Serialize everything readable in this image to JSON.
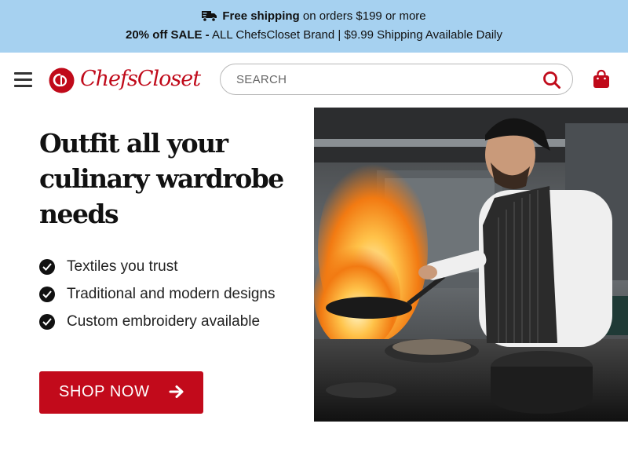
{
  "announcement": {
    "line1_bold": "Free shipping",
    "line1_rest": " on orders $199 or more",
    "line2_bold": "20% off SALE -",
    "line2_rest": " ALL ChefsCloset Brand | $9.99 Shipping Available Daily",
    "background": "#a6d1f0"
  },
  "header": {
    "logo_text": "ChefsCloset",
    "search_placeholder": "SEARCH",
    "search_value": "",
    "brand_color": "#c00a1a",
    "icons": [
      "menu-icon",
      "chefscloset-logo-icon",
      "search-icon",
      "shopping-bag-icon"
    ]
  },
  "hero": {
    "title": "Outfit all your culinary wardrobe needs",
    "features": [
      "Textiles you trust",
      "Traditional and modern designs",
      "Custom embroidery available"
    ],
    "cta_label": "SHOP NOW",
    "cta_color": "#c20a1b",
    "image_alt": "Chef cooking with flaming pan in a commercial kitchen"
  }
}
